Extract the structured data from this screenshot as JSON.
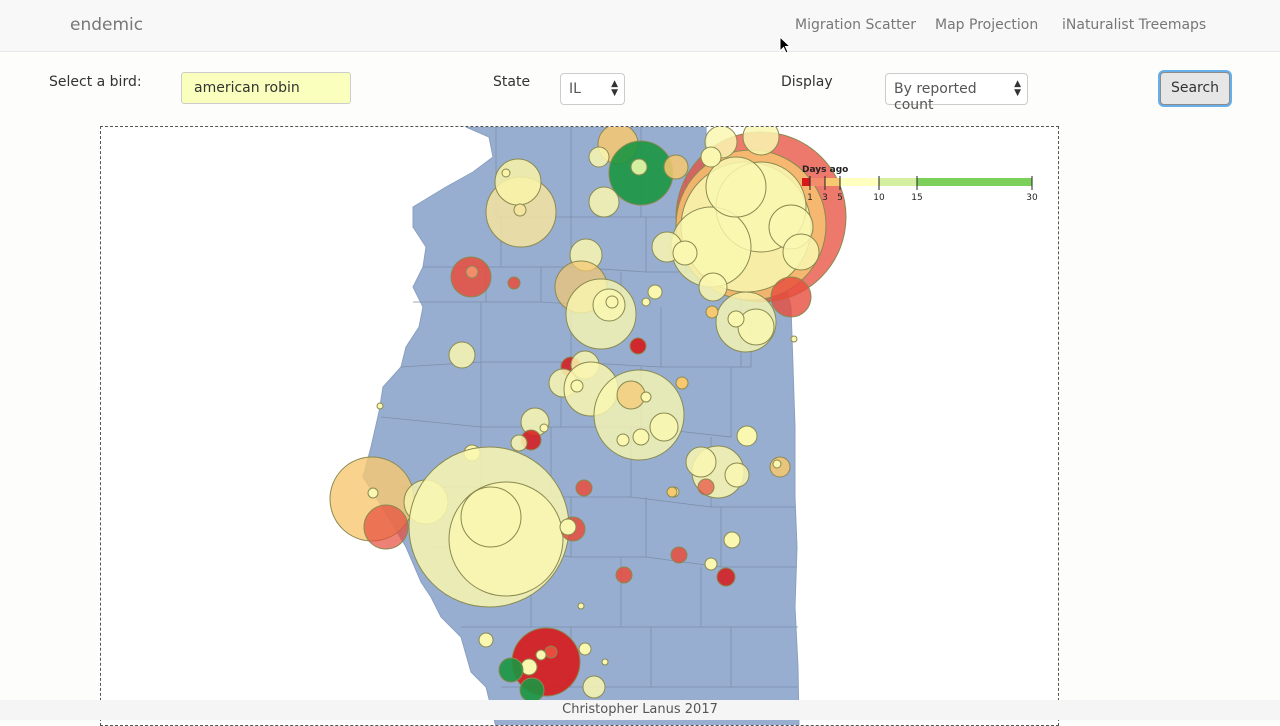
{
  "brand": "endemic",
  "nav": [
    "Migration Scatter",
    "Map Projection",
    "iNaturalist Treemaps"
  ],
  "form": {
    "bird_label": "Select a bird:",
    "bird_value": "american robin",
    "state_label": "State",
    "state_value": "IL",
    "display_label": "Display",
    "display_value": "By reported count",
    "search_label": "Search"
  },
  "legend": {
    "title": "Days ago",
    "ticks": [
      "1",
      "3",
      "5",
      "10",
      "15",
      "30"
    ]
  },
  "colors": {
    "map_fill": "#97aed1",
    "recent": "#d7191c",
    "mid": "#ffffbf",
    "old": "#1a9641"
  },
  "footer": "Christopher Lanus 2017"
}
